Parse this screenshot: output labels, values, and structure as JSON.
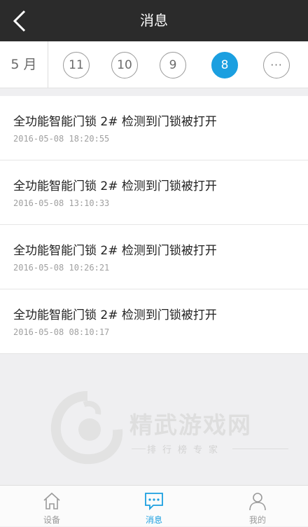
{
  "header": {
    "title": "消息",
    "back_icon": "chevron-left-icon"
  },
  "date_bar": {
    "month": "5 月",
    "days": [
      "11",
      "10",
      "9",
      "8"
    ],
    "selected_day": "8",
    "more_label": "···",
    "accent": "#1b9fe0"
  },
  "messages": [
    {
      "title": "全功能智能门锁 2# 检测到门锁被打开",
      "time": "2016-05-08 18:20:55"
    },
    {
      "title": "全功能智能门锁 2# 检测到门锁被打开",
      "time": "2016-05-08 13:10:33"
    },
    {
      "title": "全功能智能门锁 2# 检测到门锁被打开",
      "time": "2016-05-08 10:26:21"
    },
    {
      "title": "全功能智能门锁 2# 检测到门锁被打开",
      "time": "2016-05-08 08:10:17"
    }
  ],
  "watermark": {
    "title": "精武游戏网",
    "subtitle": "排行榜专家"
  },
  "tabbar": {
    "tabs": [
      {
        "label": "设备",
        "icon": "home-icon"
      },
      {
        "label": "消息",
        "icon": "chat-icon"
      },
      {
        "label": "我的",
        "icon": "person-icon"
      }
    ],
    "active": "消息"
  }
}
